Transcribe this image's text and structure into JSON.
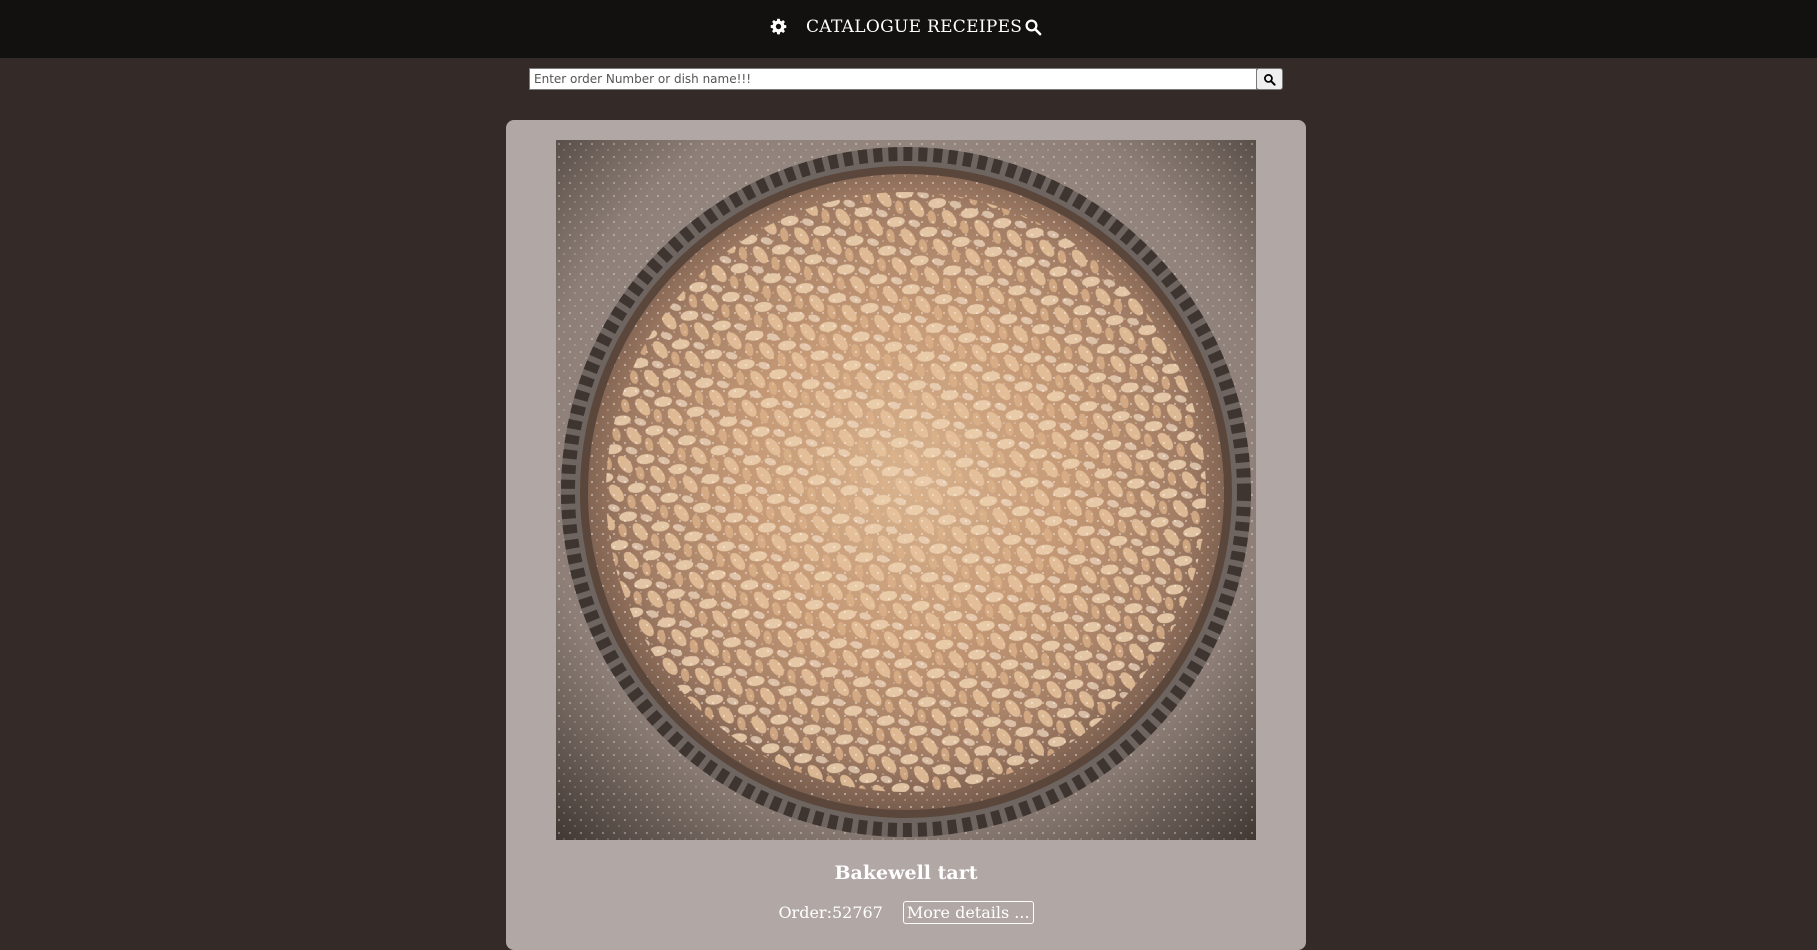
{
  "header": {
    "title": "CATALOGUE RECEIPES",
    "settings_icon": "gear-icon",
    "search_icon": "search-icon"
  },
  "search": {
    "placeholder": "Enter order Number or dish name!!!",
    "value": "",
    "button_icon": "search-icon"
  },
  "dish": {
    "name": "Bakewell tart",
    "order_label": "Order:52767",
    "details_button": "More details ...",
    "image_alt": "Bakewell tart"
  },
  "colors": {
    "header_bg": "#131110",
    "page_bg": "#342b29",
    "card_bg": "#b1a7a4",
    "text": "#ffffff"
  }
}
